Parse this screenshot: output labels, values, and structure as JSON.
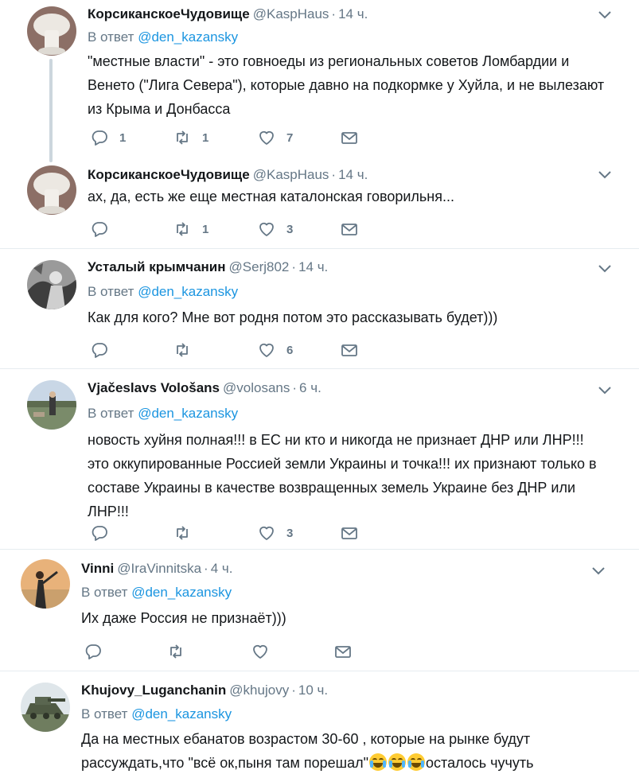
{
  "tweets": [
    {
      "name": "КорсиканскоеЧудовище",
      "handle": "@KaspHaus",
      "separator": "·",
      "time": "14 ч.",
      "reply_prefix": "В ответ",
      "reply_to": "@den_kazansky",
      "text": "\"местные власти\" - это говноеды из региональных советов Ломбардии и Венето (\"Лига Севера\"), которые давно на подкормке у Хуйла, и не вылезают из Крыма и Донбасса",
      "replies": "1",
      "retweets": "1",
      "likes": "7"
    },
    {
      "name": "КорсиканскоеЧудовище",
      "handle": "@KaspHaus",
      "separator": "·",
      "time": "14 ч.",
      "text": "ах, да, есть же еще местная каталонская говорильня...",
      "replies": "",
      "retweets": "1",
      "likes": "3"
    },
    {
      "name": "Усталый крымчанин",
      "handle": "@Serj802",
      "separator": "·",
      "time": "14 ч.",
      "reply_prefix": "В ответ",
      "reply_to": "@den_kazansky",
      "text": "Как для кого? Мне вот родня потом это рассказывать будет)))",
      "replies": "",
      "retweets": "",
      "likes": "6"
    },
    {
      "name": "Vjačeslavs Vološans",
      "handle": "@volosans",
      "separator": "·",
      "time": "6 ч.",
      "reply_prefix": "В ответ",
      "reply_to": "@den_kazansky",
      "text": "новость хуйня полная!!! в ЕС ни кто и никогда не признает ДНР или ЛНР!!!\nэто оккупированные Россией земли Украины и точка!!! их признают только в составе Украины в качестве возвращенных земель Украине без ДНР или ЛНР!!!",
      "replies": "",
      "retweets": "",
      "likes": "3"
    },
    {
      "name": "Vinni",
      "handle": "@IraVinnitska",
      "separator": "·",
      "time": "4 ч.",
      "reply_prefix": "В ответ",
      "reply_to": "@den_kazansky",
      "text": "Их даже Россия не признаёт)))",
      "replies": "",
      "retweets": "",
      "likes": ""
    },
    {
      "name": "Khujovy_Luganchanin",
      "handle": "@khujovy",
      "separator": "·",
      "time": "10 ч.",
      "reply_prefix": "В ответ",
      "reply_to": "@den_kazansky",
      "text_line1": "Да на местных ебанатов возрастом 30-60 , которые на рынке будут",
      "text_line2_a": "рассуждать,что \"всё ок,пыня там порешал\"",
      "text_line2_b": "осталось чучуть",
      "emoji": "face-with-tears-of-joy-icon"
    }
  ],
  "colors": {
    "text": "#14171a",
    "secondary": "#657786",
    "link": "#1b95e0",
    "divider": "#e6ecf0",
    "thread_line": "#ccd6dd"
  }
}
